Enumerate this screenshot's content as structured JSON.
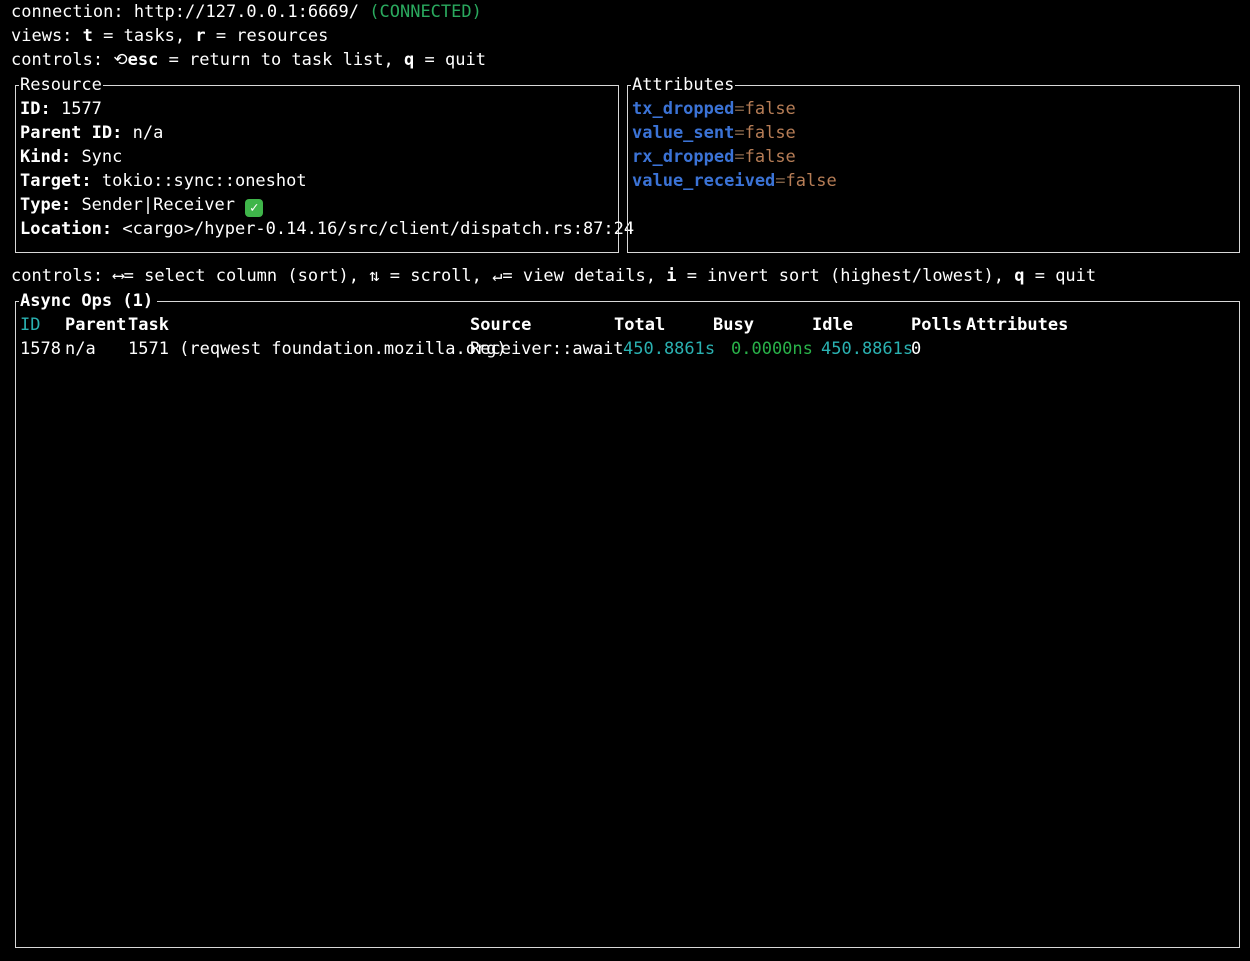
{
  "header": {
    "connection_label": "connection:",
    "connection_url": "http://127.0.0.1:6669/",
    "connection_status": "(CONNECTED)",
    "views_label": "views:",
    "views_t_key": "t",
    "views_t_text": "= tasks,",
    "views_r_key": "r",
    "views_r_text": "= resources",
    "controls_label": "controls:",
    "controls_esc_key": "esc",
    "controls_esc_text": "= return to task list,",
    "controls_q_key": "q",
    "controls_q_text": "= quit"
  },
  "resource": {
    "title": "Resource",
    "fields": [
      {
        "label": "ID:",
        "value": "1577"
      },
      {
        "label": "Parent ID:",
        "value": "n/a"
      },
      {
        "label": "Kind:",
        "value": "Sync"
      },
      {
        "label": "Target:",
        "value": "tokio::sync::oneshot"
      },
      {
        "label": "Type:",
        "value": "Sender|Receiver"
      },
      {
        "label": "Location:",
        "value": "<cargo>/hyper-0.14.16/src/client/dispatch.rs:87:24"
      }
    ],
    "type_check_icon": "check-mark-icon"
  },
  "attributes": {
    "title": "Attributes",
    "items": [
      {
        "key": "tx_dropped",
        "eq": "=",
        "value": "false"
      },
      {
        "key": "value_sent",
        "eq": "=",
        "value": "false"
      },
      {
        "key": "rx_dropped",
        "eq": "=",
        "value": "false"
      },
      {
        "key": "value_received",
        "eq": "=",
        "value": "false"
      }
    ]
  },
  "controls2": {
    "label": "controls:",
    "select_text": "= select column (sort),",
    "scroll_text": "= scroll,",
    "details_text": "= view details,",
    "invert_key": "i",
    "invert_text": "= invert sort (highest/lowest),",
    "quit_key": "q",
    "quit_text": "= quit"
  },
  "async_ops": {
    "title": "Async Ops (1)",
    "headers": {
      "id": "ID",
      "parent": "Parent",
      "task": "Task",
      "source": "Source",
      "total": "Total",
      "busy": "Busy",
      "idle": "Idle",
      "polls": "Polls",
      "attributes": "Attributes"
    },
    "rows": [
      {
        "id": "1578",
        "parent": "n/a",
        "task": "1571 (reqwest foundation.mozilla.org)",
        "source": "Receiver::await",
        "total": "450.8861s",
        "busy": "0.0000ns",
        "idle": "450.8861s",
        "polls": "0",
        "attributes": ""
      }
    ]
  },
  "colors": {
    "background": "#000000",
    "connected": "#2aa95e",
    "attr_key": "#3b73d6",
    "attr_value": "#b67d56",
    "time_cyan": "#2ab1b1",
    "busy_green": "#29b149"
  }
}
